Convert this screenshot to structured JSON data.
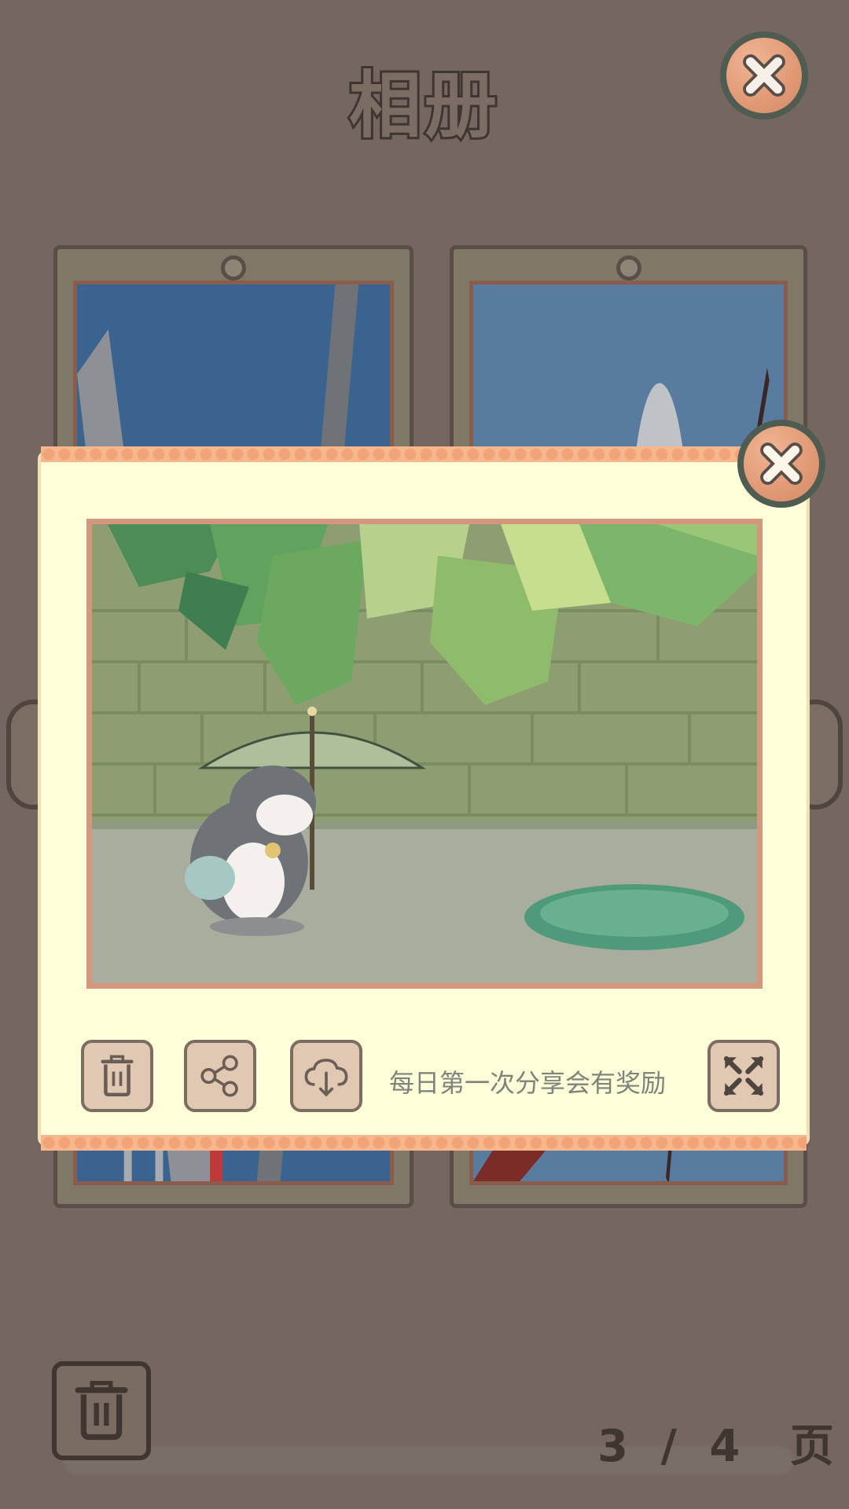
{
  "album": {
    "title": "相册",
    "hint": "每日第一次分享会有奖励",
    "pager": {
      "current": "3",
      "separator": "/",
      "total": "4",
      "unit": "页"
    }
  },
  "icons": {
    "close": "close-icon",
    "delete": "trash-icon",
    "share": "share-icon",
    "download": "cloud-download-icon",
    "fullscreen": "fullscreen-icon"
  },
  "colors": {
    "background": "#75665f",
    "popup": "#fefed8",
    "accent": "#e29b77",
    "button": "#e0c8b3"
  }
}
